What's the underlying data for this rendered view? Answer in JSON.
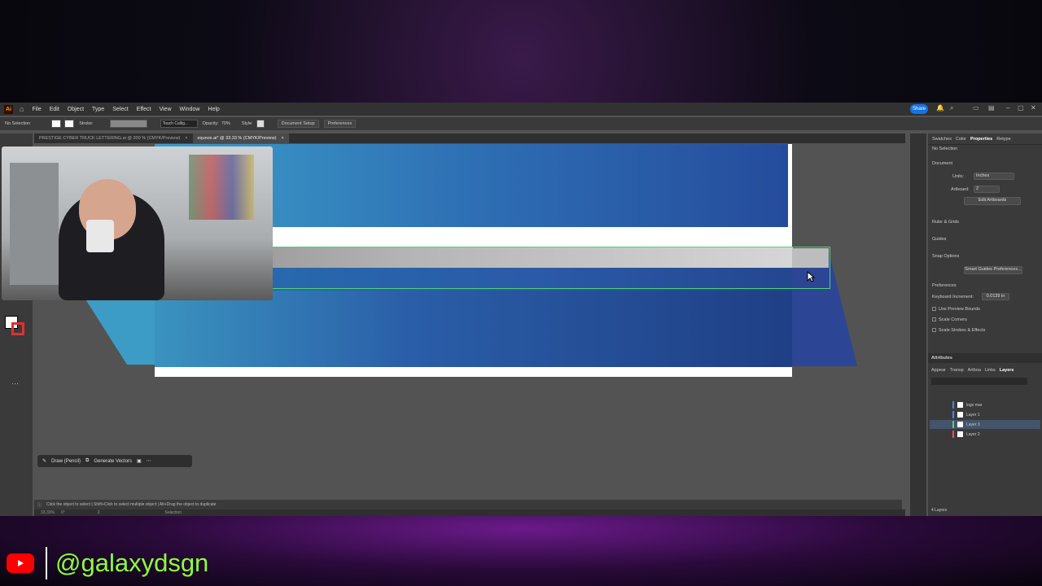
{
  "menu": {
    "logo": "Ai",
    "items": [
      "File",
      "Edit",
      "Object",
      "Type",
      "Select",
      "Effect",
      "View",
      "Window",
      "Help"
    ],
    "share": "Share"
  },
  "control": {
    "no_selection": "No Selection",
    "stroke_label": "Stroke:",
    "brush": "Touch Callig...",
    "opacity_label": "Opacity:",
    "opacity_value": "70%",
    "style_label": "Style:",
    "document_setup": "Document Setup",
    "preferences": "Preferences"
  },
  "tabs": [
    {
      "label": "PRESTIGE CYBER TRUCK LETTERING.ai @ 200 % (CMYK/Preview)",
      "close": "×"
    },
    {
      "label": "equnox.ai* @ 33.33 % (CMYK/Preview)",
      "close": "×"
    }
  ],
  "float_bar": {
    "draw": "Draw (Pencil)",
    "generate": "Generate Vectors"
  },
  "status": {
    "hint": "Click the object to select | Shift+Click to select multiple object | Alt+Drag the object to duplicate",
    "zoom": "33.33%",
    "rotation": "0°",
    "artboard": "2",
    "tool": "Selection"
  },
  "properties": {
    "tabs": [
      "Swatches",
      "Color",
      "Properties",
      "Retype"
    ],
    "no_selection": "No Selection",
    "document": "Document",
    "units_label": "Units:",
    "units_value": "Inches",
    "artboard_label": "Artboard:",
    "artboard_value": "2",
    "edit_artboards": "Edit Artboards",
    "rulers_grids": "Ruler & Grids",
    "guides": "Guides",
    "snap_options": "Snap Options",
    "smart_guides": "Smart Guides Preferences...",
    "preferences": "Preferences",
    "keyboard_increment_label": "Keyboard Increment:",
    "keyboard_increment_value": "0.0139 in",
    "use_preview_bounds": "Use Preview Bounds",
    "scale_corners": "Scale Corners",
    "scale_strokes": "Scale Strokes & Effects"
  },
  "attributes": {
    "title": "Attributes",
    "tabs": [
      "Appear",
      "Transp",
      "Artboa",
      "Links",
      "Layers"
    ],
    "footer": "4 Layers",
    "layers": [
      {
        "name": "logo mar",
        "color": "#4f7fff"
      },
      {
        "name": "Layer 1",
        "color": "#4f7fff"
      },
      {
        "name": "Layer 3",
        "color": "#4fd27a"
      },
      {
        "name": "Layer 2",
        "color": "#ff5050"
      }
    ]
  },
  "brand": {
    "handle": "@galaxydsgn"
  }
}
